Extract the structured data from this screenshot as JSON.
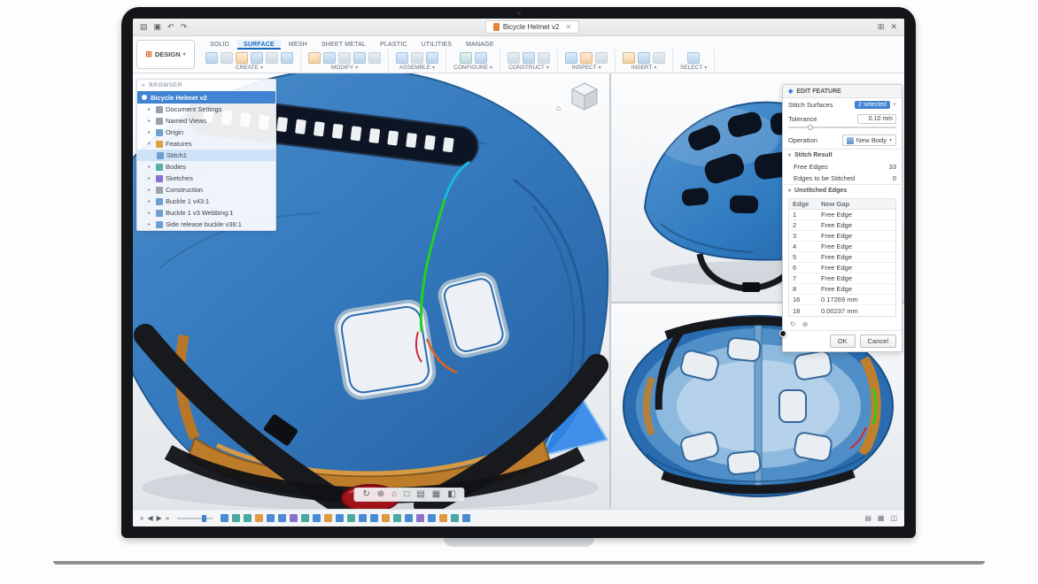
{
  "titlebar": {
    "doc_tab": "Bicycle Helmet v2"
  },
  "app": {
    "design_menu": "DESIGN",
    "tabs": [
      "SOLID",
      "SURFACE",
      "MESH",
      "SHEET METAL",
      "PLASTIC",
      "UTILITIES",
      "MANAGE"
    ],
    "active_tab": "SURFACE",
    "groups": [
      "CREATE",
      "MODIFY",
      "ASSEMBLE",
      "CONFIGURE",
      "CONSTRUCT",
      "INSPECT",
      "INSERT",
      "SELECT"
    ]
  },
  "browser": {
    "title": "BROWSER",
    "doc_row": "Bicycle Helmet v2",
    "items": [
      "Document Settings",
      "Named Views",
      "Origin",
      "Features",
      "Stitch1",
      "Bodies",
      "Sketches",
      "Construction",
      "Buckle 1 v43:1",
      "Buckle 1 v3 Webbing:1",
      "Side release buckle v36:1"
    ]
  },
  "edit_feature": {
    "title": "EDIT FEATURE",
    "stitch_label": "Stitch Surfaces",
    "stitch_value": "2 selected",
    "tolerance_label": "Tolerance",
    "tolerance_value": "0.10 mm",
    "operation_label": "Operation",
    "operation_value": "New Body",
    "stitch_result_header": "Stitch Result",
    "free_edges_label": "Free Edges",
    "free_edges_value": "33",
    "to_stitch_label": "Edges to be Stitched",
    "to_stitch_value": "0",
    "unstitched_header": "Unstitched Edges",
    "col_edge": "Edge",
    "col_gap": "New Gap",
    "rows": [
      [
        "1",
        "Free Edge"
      ],
      [
        "2",
        "Free Edge"
      ],
      [
        "3",
        "Free Edge"
      ],
      [
        "4",
        "Free Edge"
      ],
      [
        "5",
        "Free Edge"
      ],
      [
        "6",
        "Free Edge"
      ],
      [
        "7",
        "Free Edge"
      ],
      [
        "8",
        "Free Edge"
      ],
      [
        "16",
        "0.17269 mm"
      ],
      [
        "18",
        "0.00237 mm"
      ]
    ],
    "ok": "OK",
    "cancel": "Cancel"
  },
  "colors": {
    "accent_blue": "#3f83d2",
    "helmet_blue": "#3076bb",
    "pad_orange": "#bd7c2a",
    "selected_edge_green": "#1ed322"
  },
  "icons": {
    "menu": "▤",
    "save": "▣",
    "undo": "↶",
    "redo": "↷",
    "close": "✕",
    "grid": "⊞",
    "caret_down": "▾",
    "caret_right": "▸",
    "diamond": "◆",
    "collapse": "«",
    "chip_close": "×",
    "home": "⌂",
    "nav": [
      "↻",
      "⊕",
      "⌂",
      "□",
      "▤",
      "▦",
      "◧"
    ],
    "play": [
      "«",
      "◀",
      "▶",
      "»"
    ],
    "tl_right": [
      "▤",
      "▦",
      "◫"
    ]
  }
}
